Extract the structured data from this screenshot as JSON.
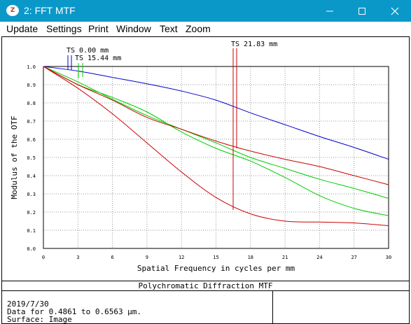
{
  "window": {
    "title": "2: FFT MTF",
    "app_icon": "zemax-app-icon"
  },
  "menu": [
    "Update",
    "Settings",
    "Print",
    "Window",
    "Text",
    "Zoom"
  ],
  "plot": {
    "title": "Polychromatic Diffraction MTF",
    "date": "2019/7/30",
    "data_range": "Data for 0.4861 to 0.6563 µm.",
    "surface": "Surface: Image",
    "field_labels": [
      "TS 0.00 mm",
      "TS 15.44 mm",
      "TS 21.83 mm"
    ]
  },
  "chart_data": {
    "type": "line",
    "title": "Polychromatic Diffraction MTF",
    "xlabel": "Spatial Frequency in cycles per mm",
    "ylabel": "Modulus of the OTF",
    "xlim": [
      0,
      30
    ],
    "ylim": [
      0,
      1
    ],
    "x_ticks": [
      0,
      3,
      6,
      9,
      12,
      15,
      18,
      21,
      24,
      27,
      30
    ],
    "y_ticks": [
      "0.0",
      "0.1",
      "0.2",
      "0.3",
      "0.4",
      "0.5",
      "0.6",
      "0.7",
      "0.8",
      "0.9",
      "1.0"
    ],
    "grid": true,
    "colors": {
      "blue": "#0000cc",
      "green": "#00cc00",
      "red": "#cc0000"
    },
    "series": [
      {
        "color": "blue",
        "x": [
          0,
          3,
          6,
          9,
          12,
          15,
          18,
          21,
          24,
          27,
          30
        ],
        "y": [
          1.0,
          0.975,
          0.94,
          0.905,
          0.865,
          0.815,
          0.745,
          0.68,
          0.615,
          0.555,
          0.49
        ]
      },
      {
        "color": "green",
        "x": [
          0,
          3,
          6,
          9,
          12,
          15,
          18,
          21,
          24,
          27,
          30
        ],
        "y": [
          1.0,
          0.915,
          0.82,
          0.73,
          0.655,
          0.58,
          0.5,
          0.44,
          0.38,
          0.33,
          0.275
        ]
      },
      {
        "color": "green",
        "x": [
          0,
          3,
          6,
          9,
          12,
          15,
          18,
          21,
          24,
          27,
          30
        ],
        "y": [
          1.0,
          0.9,
          0.83,
          0.75,
          0.64,
          0.55,
          0.48,
          0.39,
          0.29,
          0.22,
          0.18
        ]
      },
      {
        "color": "red",
        "x": [
          0,
          3,
          6,
          9,
          12,
          15,
          18,
          21,
          24,
          27,
          30
        ],
        "y": [
          1.0,
          0.9,
          0.815,
          0.72,
          0.655,
          0.59,
          0.535,
          0.49,
          0.45,
          0.4,
          0.35
        ]
      },
      {
        "color": "red",
        "x": [
          0,
          3,
          6,
          9,
          12,
          15,
          18,
          21,
          24,
          27,
          30
        ],
        "y": [
          1.0,
          0.88,
          0.74,
          0.58,
          0.42,
          0.28,
          0.19,
          0.15,
          0.145,
          0.14,
          0.125
        ]
      }
    ],
    "field_markers": [
      {
        "label": "TS 0.00 mm",
        "x": 2.3,
        "color": "blue"
      },
      {
        "label": "TS 15.44 mm",
        "x": 3.0,
        "color": "green"
      },
      {
        "label": "TS 21.83 mm",
        "x": 16.8,
        "color": "red"
      }
    ]
  }
}
